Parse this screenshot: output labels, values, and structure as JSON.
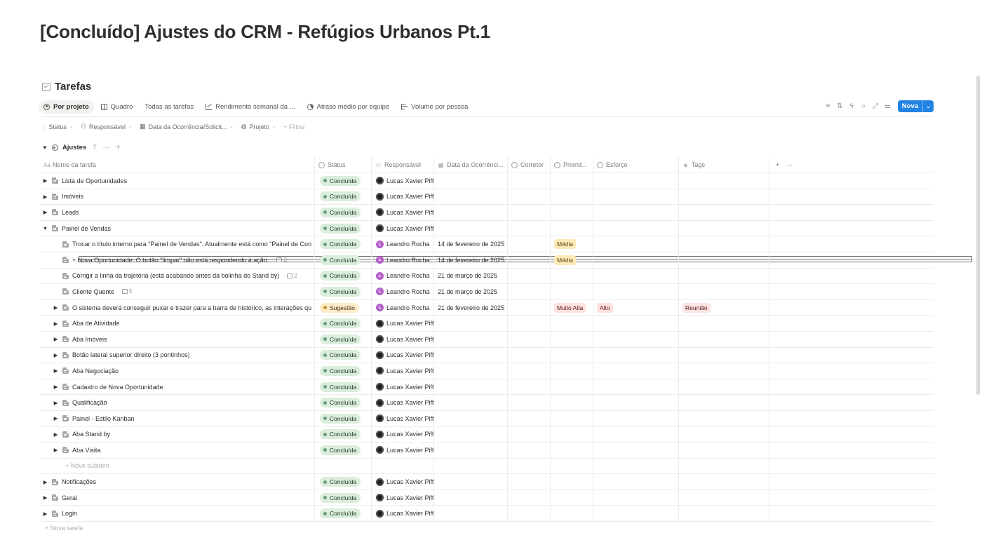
{
  "page": {
    "title": "[Concluído] Ajustes do CRM - Refúgios Urbanos Pt.1"
  },
  "database": {
    "title": "Tarefas",
    "icon": "checkbox-icon"
  },
  "views": [
    {
      "label": "Por projeto",
      "icon": "target-icon",
      "active": true
    },
    {
      "label": "Quadro",
      "icon": "board-icon",
      "active": false
    },
    {
      "label": "Todas as tarefas",
      "icon": "table-icon",
      "active": false
    },
    {
      "label": "Rendimento semanal da ...",
      "icon": "line-chart-icon",
      "active": false
    },
    {
      "label": "Atraso médio por equipe",
      "icon": "pie-chart-icon",
      "active": false
    },
    {
      "label": "Volume por pessoa",
      "icon": "bar-chart-icon",
      "active": false
    }
  ],
  "toolbar": {
    "icons": [
      "filter-icon",
      "sort-icon",
      "automation-icon",
      "search-icon",
      "expand-icon",
      "settings-icon"
    ],
    "new_label": "Nova"
  },
  "filters": [
    {
      "label": "Status",
      "icon": "status-icon"
    },
    {
      "label": "Responsável",
      "icon": "people-icon"
    },
    {
      "label": "Data da Ocorrência/Solicit...",
      "icon": "calendar-icon"
    },
    {
      "label": "Projeto",
      "icon": "project-icon"
    }
  ],
  "add_filter_label": "+ Filtrar",
  "group": {
    "name": "Ajustes",
    "count": "7",
    "more": "···",
    "add": "+"
  },
  "columns": {
    "name": "Nome da tarefa",
    "status": "Status",
    "responsavel": "Responsável",
    "data": "Data da Ocorrênci...",
    "corretor": "Corretor",
    "prioridade": "Priorid...",
    "esforco": "Esforço",
    "tags": "Tags",
    "add": "+",
    "more": "···"
  },
  "rows": [
    {
      "name": "Lista de Oportunidades",
      "level": 0,
      "toggle": "▶",
      "status": "Concluída",
      "responsavel": "Lucas Xavier Piffer",
      "avatar": "dark",
      "data": "",
      "prioridade": "",
      "esforco": "",
      "tags": "",
      "comments": ""
    },
    {
      "name": "Imóveis",
      "level": 0,
      "toggle": "▶",
      "status": "Concluída",
      "responsavel": "Lucas Xavier Piffer",
      "avatar": "dark",
      "data": "",
      "prioridade": "",
      "esforco": "",
      "tags": "",
      "comments": ""
    },
    {
      "name": "Leads",
      "level": 0,
      "toggle": "▶",
      "status": "Concluída",
      "responsavel": "Lucas Xavier Piffer",
      "avatar": "dark",
      "data": "",
      "prioridade": "",
      "esforco": "",
      "tags": "",
      "comments": ""
    },
    {
      "name": "Painel de Vendas",
      "level": 0,
      "toggle": "▼",
      "status": "Concluída",
      "responsavel": "Lucas Xavier Piffer",
      "avatar": "dark",
      "data": "",
      "prioridade": "",
      "esforco": "",
      "tags": "",
      "comments": ""
    },
    {
      "name": "Trocar o título interno para \"Painel de Vendas\". Atualmente está como \"Painel de Con",
      "level": 1,
      "toggle": "",
      "status": "Concluída",
      "responsavel": "Leandro Rocha",
      "avatar": "purple",
      "data": "14 de fevereiro de 2025",
      "prioridade": "Média",
      "esforco": "",
      "tags": "",
      "comments": ""
    },
    {
      "name": "+ Nova Oportunidade: O botão \"limpar\" não está respondendo à ação.",
      "level": 1,
      "toggle": "",
      "status": "Concluída",
      "responsavel": "Leandro Rocha",
      "avatar": "purple",
      "data": "14 de fevereiro de 2025",
      "prioridade": "Média",
      "esforco": "",
      "tags": "",
      "comments": "3"
    },
    {
      "name": "Corrigir a linha da trajetória (está acabando antes da bolinha do Stand by)",
      "level": 1,
      "toggle": "",
      "status": "Concluída",
      "responsavel": "Leandro Rocha",
      "avatar": "purple",
      "data": "21 de março de 2025",
      "prioridade": "",
      "esforco": "",
      "tags": "",
      "comments": "2"
    },
    {
      "name": "Cliente Quente",
      "level": 1,
      "toggle": "",
      "status": "Concluída",
      "responsavel": "Leandro Rocha",
      "avatar": "purple",
      "data": "21 de março de 2025",
      "prioridade": "",
      "esforco": "",
      "tags": "",
      "comments": "5"
    },
    {
      "name": "O sistema deverá conseguir puxar e trazer para a barra de histórico, as interações qu",
      "level": 1,
      "toggle": "▶",
      "status": "Sugestão",
      "responsavel": "Leandro Rocha",
      "avatar": "purple",
      "data": "21 de fevereiro de 2025",
      "prioridade": "Muito Alta",
      "esforco": "Alto",
      "tags": "Reunião",
      "comments": ""
    },
    {
      "name": "Aba de Atividade",
      "level": 1,
      "toggle": "▶",
      "status": "Concluída",
      "responsavel": "Lucas Xavier Piffer",
      "avatar": "dark",
      "data": "",
      "prioridade": "",
      "esforco": "",
      "tags": "",
      "comments": ""
    },
    {
      "name": "Aba Imóveis",
      "level": 1,
      "toggle": "▶",
      "status": "Concluída",
      "responsavel": "Lucas Xavier Piffer",
      "avatar": "dark",
      "data": "",
      "prioridade": "",
      "esforco": "",
      "tags": "",
      "comments": ""
    },
    {
      "name": "Botão lateral superior direito (3 pontinhos)",
      "level": 1,
      "toggle": "▶",
      "status": "Concluída",
      "responsavel": "Lucas Xavier Piffer",
      "avatar": "dark",
      "data": "",
      "prioridade": "",
      "esforco": "",
      "tags": "",
      "comments": ""
    },
    {
      "name": "Aba Negociação",
      "level": 1,
      "toggle": "▶",
      "status": "Concluída",
      "responsavel": "Lucas Xavier Piffer",
      "avatar": "dark",
      "data": "",
      "prioridade": "",
      "esforco": "",
      "tags": "",
      "comments": ""
    },
    {
      "name": "Cadastro de Nova Oportunidade",
      "level": 1,
      "toggle": "▶",
      "status": "Concluída",
      "responsavel": "Lucas Xavier Piffer",
      "avatar": "dark",
      "data": "",
      "prioridade": "",
      "esforco": "",
      "tags": "",
      "comments": ""
    },
    {
      "name": "Qualificação",
      "level": 1,
      "toggle": "▶",
      "status": "Concluída",
      "responsavel": "Lucas Xavier Piffer",
      "avatar": "dark",
      "data": "",
      "prioridade": "",
      "esforco": "",
      "tags": "",
      "comments": ""
    },
    {
      "name": "Painel - Estilo Kanban",
      "level": 1,
      "toggle": "▶",
      "status": "Concluída",
      "responsavel": "Lucas Xavier Piffer",
      "avatar": "dark",
      "data": "",
      "prioridade": "",
      "esforco": "",
      "tags": "",
      "comments": ""
    },
    {
      "name": "Aba Stand by",
      "level": 1,
      "toggle": "▶",
      "status": "Concluída",
      "responsavel": "Lucas Xavier Piffer",
      "avatar": "dark",
      "data": "",
      "prioridade": "",
      "esforco": "",
      "tags": "",
      "comments": ""
    },
    {
      "name": "Aba Visita",
      "level": 1,
      "toggle": "▶",
      "status": "Concluída",
      "responsavel": "Lucas Xavier Piffer",
      "avatar": "dark",
      "data": "",
      "prioridade": "",
      "esforco": "",
      "tags": "",
      "comments": ""
    },
    {
      "type": "add-subitem",
      "name": "+ Novo subitem",
      "level": 1
    },
    {
      "name": "Notificações",
      "level": 0,
      "toggle": "▶",
      "status": "Concluída",
      "responsavel": "Lucas Xavier Piffer",
      "avatar": "dark",
      "data": "",
      "prioridade": "",
      "esforco": "",
      "tags": "",
      "comments": ""
    },
    {
      "name": "Geral",
      "level": 0,
      "toggle": "▶",
      "status": "Concluída",
      "responsavel": "Lucas Xavier Piffer",
      "avatar": "dark",
      "data": "",
      "prioridade": "",
      "esforco": "",
      "tags": "",
      "comments": ""
    },
    {
      "name": "Login",
      "level": 0,
      "toggle": "▶",
      "status": "Concluída",
      "responsavel": "Lucas Xavier Piffer",
      "avatar": "dark",
      "data": "",
      "prioridade": "",
      "esforco": "",
      "tags": "",
      "comments": ""
    }
  ],
  "new_task_label": "+ Nova tarefa",
  "colors": {
    "accent": "#2383e2",
    "done_bg": "#dbeddb",
    "suggestion_bg": "#fdecc8"
  }
}
